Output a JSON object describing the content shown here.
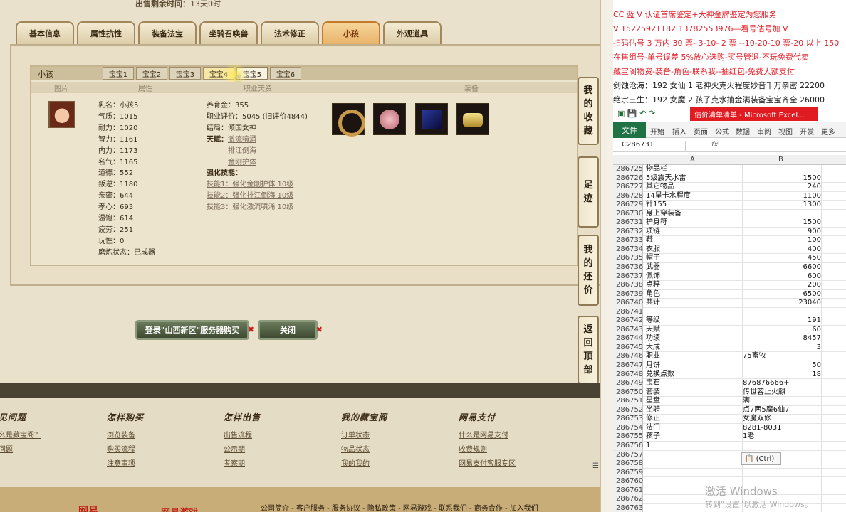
{
  "sale": {
    "label": "出售剩余时间：",
    "value": "13天0时"
  },
  "main_tabs": [
    "基本信息",
    "属性抗性",
    "装备法宝",
    "坐骑召唤兽",
    "法术修正",
    "小孩",
    "外观道具"
  ],
  "section_title": "小孩",
  "baby_tabs": [
    "宝宝1",
    "宝宝2",
    "宝宝3",
    "宝宝4",
    "宝宝5",
    "宝宝6"
  ],
  "columns": {
    "picture": "图片",
    "attributes": "属性",
    "career": "职业天资",
    "equipment": "装备"
  },
  "stats_left": [
    "乳名：小孩5",
    "气质：1015",
    "耐力：1020",
    "智力：1161",
    "内力：1173",
    "名气：1165",
    "道德：552",
    "叛逆：1180",
    "亲密：644",
    "孝心：693",
    "温饱：614",
    "疲劳：251",
    "玩性：0",
    "磨炼状态：已成器"
  ],
  "stats_right": {
    "money": "养育金：355",
    "rating": "职业评价：5045 (旧评价4844)",
    "ending": "结局：倾国女神",
    "talent_label": "天赋：",
    "talents": [
      "激流噴涌",
      "排江倒海",
      "金刚护体"
    ],
    "skill_label": "强化技能：",
    "skills": [
      "技能1：强化金刚护体 10级",
      "技能2：强化排江倒海 10级",
      "技能3：强化激流噴涌 10级"
    ]
  },
  "side_buttons": [
    "我的收藏",
    "足迹",
    "我的还价",
    "返回顶部"
  ],
  "actions": {
    "buy": "登录\"山西新区\"服务器购买",
    "close": "关闭"
  },
  "footer": {
    "cols": [
      {
        "title": "见问题",
        "links": [
          "么是藏宝阁？",
          "问题"
        ]
      },
      {
        "title": "怎样购买",
        "links": [
          "浏览装备",
          "购买流程",
          "注意事项"
        ]
      },
      {
        "title": "怎样出售",
        "links": [
          "出售流程",
          "公示期",
          "考察期"
        ]
      },
      {
        "title": "我的藏宝阁",
        "links": [
          "订单状态",
          "物品状态",
          "我的我的"
        ]
      },
      {
        "title": "网易支付",
        "links": [
          "什么是网易支付",
          "收费规则",
          "网易支付客服专区"
        ]
      }
    ],
    "bottom_links": "公司简介 - 客户服务 - 服务协议 - 隐私政策 - 网易游戏 - 联系我们 - 商务合作 - 加入我们",
    "logo_a": "网易",
    "logo_b": "网易游戏"
  },
  "overlay_lines": [
    {
      "text": "CC 蓝 V 认证首席鉴定+大神金牌鉴定为您服务",
      "color": "red"
    },
    {
      "text": "V 15225921182      13782553976—看号估号加 V",
      "color": "red"
    },
    {
      "text": "扫码估号 3 万内 30 票- 3-10- 2 票 --10-20-10 票-20 以上 150",
      "color": "red"
    },
    {
      "text": "在售组号-单号误差 5%放心选购-买号管退-不玩免费代卖",
      "color": "red"
    },
    {
      "text": "藏宝阁物资-装备-角色-联系我--抽红包-免费大额支付",
      "color": "red"
    },
    {
      "text": "剑蚀沧海：192 女仙 1 老神火克火程度妙音千万亲密 22200",
      "color": "dark"
    },
    {
      "text": "绝宗三生：192 女魔 2 孩子克水抽金满装备宝宝齐全 26000",
      "color": "dark"
    }
  ],
  "excel": {
    "doc_title": "估价清单清单 - Microsoft Excel...",
    "ribbon": [
      "文件",
      "开始",
      "插入",
      "页面",
      "公式",
      "数据",
      "审阅",
      "视图",
      "开发",
      "更多"
    ],
    "cell_ref": "C286731",
    "fx": "fx",
    "col_a": "A",
    "col_b": "B",
    "rows": [
      [
        "286725",
        "物品栏",
        ""
      ],
      [
        "286726",
        "5级震天水雷",
        "1500"
      ],
      [
        "286727",
        "其它物品",
        "240"
      ],
      [
        "286728",
        "14星卡水程度",
        "1100"
      ],
      [
        "286729",
        "针155",
        "1300"
      ],
      [
        "286730",
        "身上穿装备",
        ""
      ],
      [
        "286731",
        "护身符",
        "1500"
      ],
      [
        "286732",
        "项链",
        "900"
      ],
      [
        "286733",
        "鞋",
        "100"
      ],
      [
        "286734",
        "衣服",
        "400"
      ],
      [
        "286735",
        "帽子",
        "450"
      ],
      [
        "286736",
        "武器",
        "6600"
      ],
      [
        "286737",
        "佩饰",
        "600"
      ],
      [
        "286738",
        "点粹",
        "200"
      ],
      [
        "286739",
        "角色",
        "6500"
      ],
      [
        "286740",
        "共计",
        "23040"
      ],
      [
        "286741",
        "",
        ""
      ],
      [
        "286742",
        "等级",
        "191"
      ],
      [
        "286743",
        "天赋",
        "60"
      ],
      [
        "286744",
        "功绩",
        "8457"
      ],
      [
        "286745",
        "大成",
        "3"
      ],
      [
        "286746",
        "职业",
        "75畜牧"
      ],
      [
        "286747",
        "月饼",
        "50"
      ],
      [
        "286748",
        "兑换点数",
        "18"
      ],
      [
        "286749",
        "宝石",
        "876876666+"
      ],
      [
        "286750",
        "套装",
        "传世容止火麒"
      ],
      [
        "286751",
        "星盘",
        "满"
      ],
      [
        "286752",
        "坐骑",
        "点7两5魔6仙7"
      ],
      [
        "286753",
        "修正",
        "女魔双修"
      ],
      [
        "286754",
        "法门",
        "8281-8031"
      ],
      [
        "286755",
        "孩子",
        "1老"
      ],
      [
        "286756",
        "1",
        ""
      ],
      [
        "286757",
        "",
        ""
      ],
      [
        "286758",
        "",
        ""
      ],
      [
        "286759",
        "",
        ""
      ],
      [
        "286760",
        "",
        ""
      ],
      [
        "286761",
        "",
        ""
      ],
      [
        "286762",
        "",
        ""
      ],
      [
        "286763",
        "",
        ""
      ]
    ],
    "paste_label": "(Ctrl)"
  },
  "watermark": {
    "line1": "激活 Windows",
    "line2": "转到\"设置\"以激活 Windows。"
  },
  "colors": {
    "accent_orange": "#e8b46a",
    "excel_green": "#207245",
    "overlay_red": "#e3202a"
  }
}
